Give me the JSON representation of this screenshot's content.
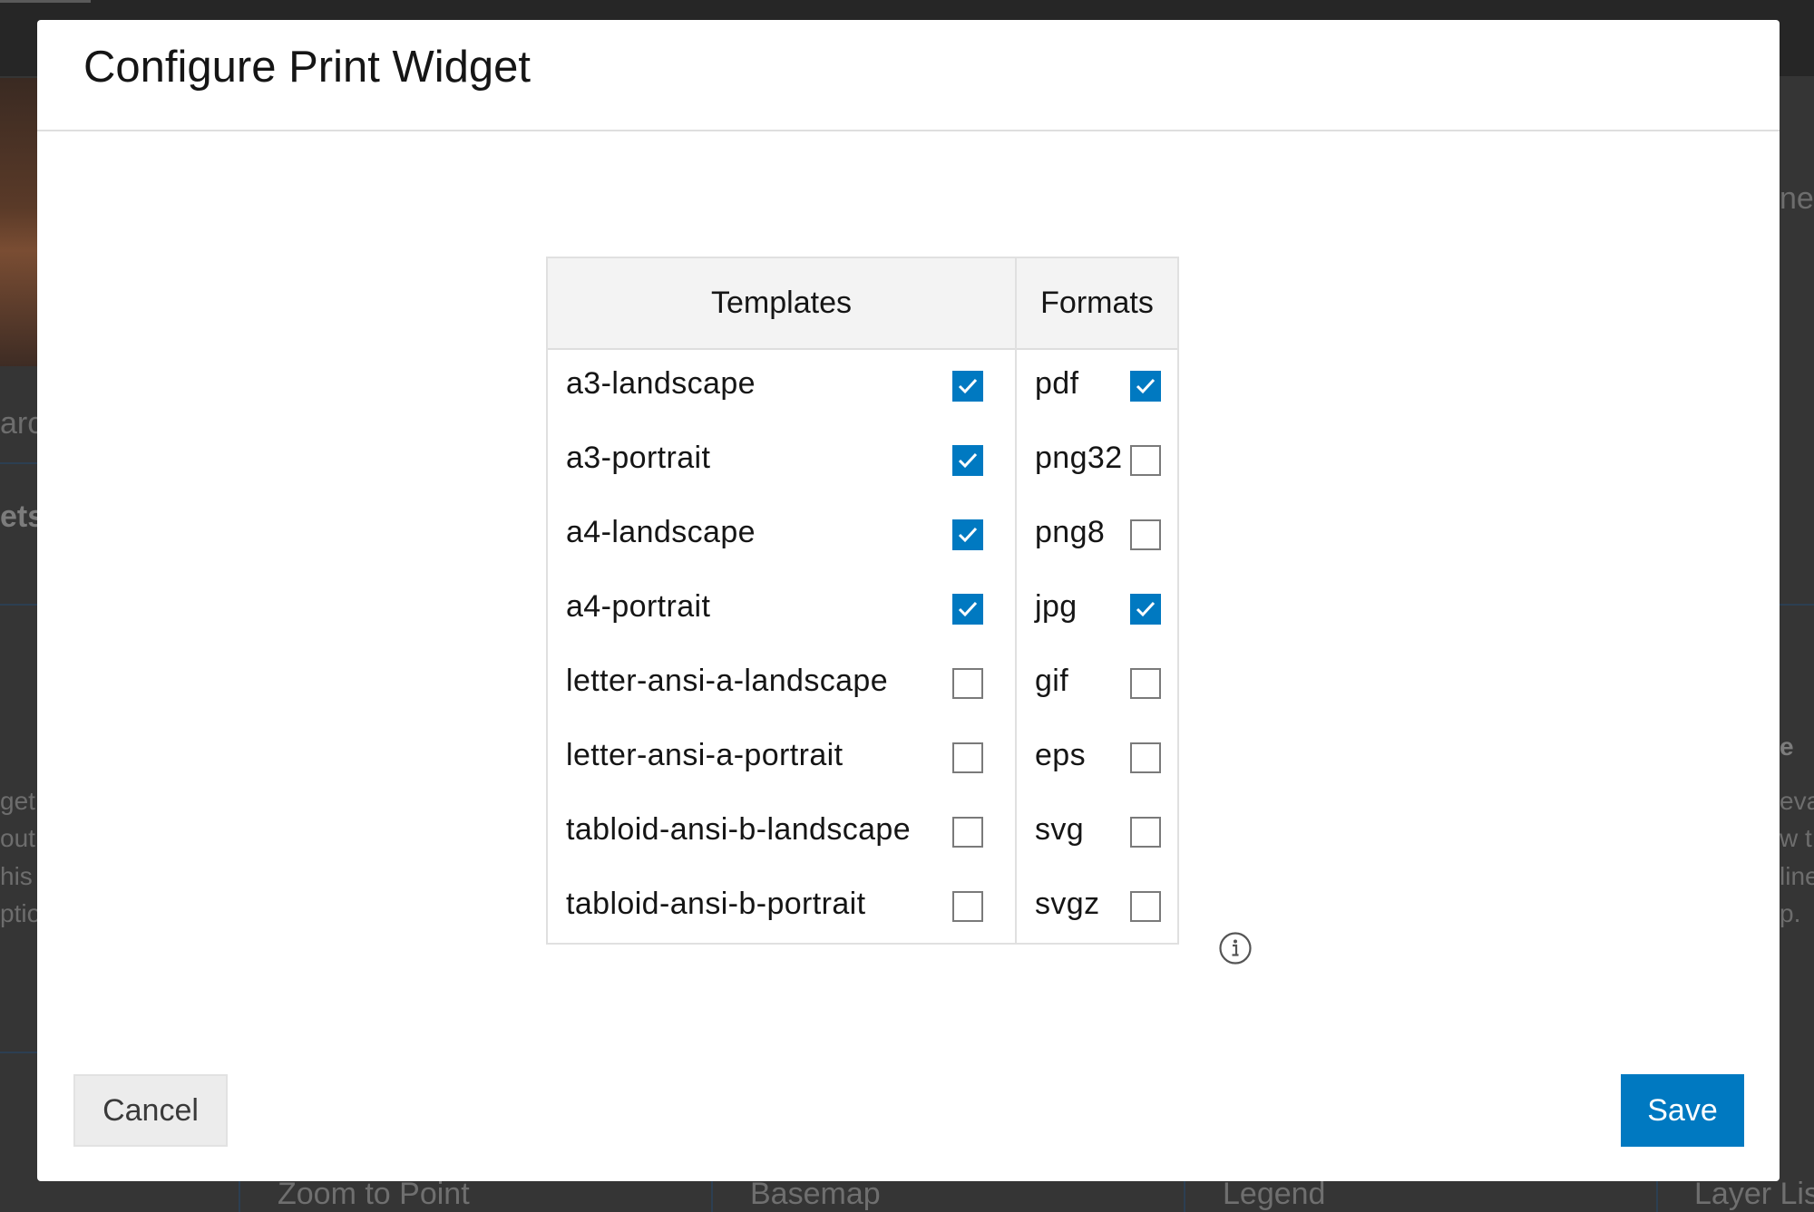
{
  "background": {
    "left_fragments": [
      "arc",
      "ets",
      "get",
      "out",
      "his",
      "ptio"
    ],
    "right_fragments": [
      "ne",
      "e",
      "eva",
      "w t",
      "line",
      "p."
    ],
    "bottom_cards": [
      "Zoom to Point",
      "Basemap",
      "Legend",
      "Layer Lis"
    ]
  },
  "modal": {
    "title": "Configure Print Widget",
    "templates_header": "Templates",
    "formats_header": "Formats",
    "templates": [
      {
        "label": "a3-landscape",
        "checked": true
      },
      {
        "label": "a3-portrait",
        "checked": true
      },
      {
        "label": "a4-landscape",
        "checked": true
      },
      {
        "label": "a4-portrait",
        "checked": true
      },
      {
        "label": "letter-ansi-a-landscape",
        "checked": false
      },
      {
        "label": "letter-ansi-a-portrait",
        "checked": false
      },
      {
        "label": "tabloid-ansi-b-landscape",
        "checked": false
      },
      {
        "label": "tabloid-ansi-b-portrait",
        "checked": false
      }
    ],
    "formats": [
      {
        "label": "pdf",
        "checked": true
      },
      {
        "label": "png32",
        "checked": false
      },
      {
        "label": "png8",
        "checked": false
      },
      {
        "label": "jpg",
        "checked": true
      },
      {
        "label": "gif",
        "checked": false
      },
      {
        "label": "eps",
        "checked": false
      },
      {
        "label": "svg",
        "checked": false
      },
      {
        "label": "svgz",
        "checked": false
      }
    ],
    "info_icon": "info-circle-icon",
    "cancel_label": "Cancel",
    "save_label": "Save"
  },
  "colors": {
    "accent": "#0079c1",
    "checkbox_border": "#7a7a7a",
    "header_bg": "#f3f3f3"
  }
}
